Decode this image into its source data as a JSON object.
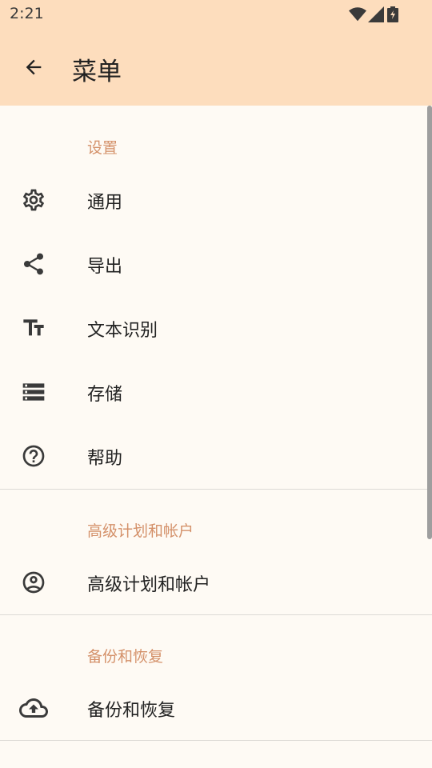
{
  "status_bar": {
    "time": "2:21"
  },
  "app_bar": {
    "title": "菜单"
  },
  "sections": {
    "settings": {
      "header": "设置",
      "items": [
        {
          "label": "通用"
        },
        {
          "label": "导出"
        },
        {
          "label": "文本识别"
        },
        {
          "label": "存储"
        },
        {
          "label": "帮助"
        }
      ]
    },
    "premium": {
      "header": "高级计划和帐户",
      "items": [
        {
          "label": "高级计划和帐户"
        }
      ]
    },
    "backup": {
      "header": "备份和恢复",
      "items": [
        {
          "label": "备份和恢复"
        }
      ]
    }
  },
  "colors": {
    "appbar": "#FDDDBD",
    "accent": "#D4916A",
    "background": "#FEFAF4"
  }
}
